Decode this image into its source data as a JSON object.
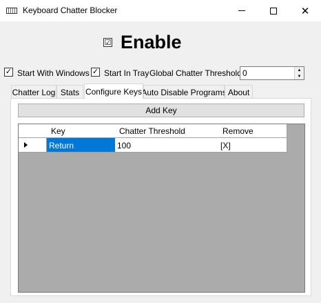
{
  "window": {
    "title": "Keyboard Chatter Blocker"
  },
  "enable": {
    "checked": "☑",
    "label": "Enable"
  },
  "options": {
    "start_with_windows": {
      "checked": "✓",
      "label": "Start With Windows"
    },
    "start_in_tray": {
      "checked": "✓",
      "label": "Start In Tray"
    },
    "threshold_label": "Global Chatter Threshold:",
    "threshold_value": "0"
  },
  "tabs": [
    {
      "label": "Chatter Log",
      "active": false
    },
    {
      "label": "Stats",
      "active": false
    },
    {
      "label": "Configure Keys",
      "active": true
    },
    {
      "label": "Auto Disable Programs",
      "active": false
    },
    {
      "label": "About",
      "active": false
    }
  ],
  "configure_keys": {
    "add_key_label": "Add Key",
    "columns": [
      "Key",
      "Chatter Threshold",
      "Remove"
    ],
    "rows": [
      {
        "key": "Return",
        "threshold": "100",
        "remove": "[X]"
      }
    ]
  },
  "icons": {
    "app": "keyboard-icon",
    "spin_up": "▲",
    "spin_down": "▼"
  },
  "colors": {
    "selection": "#0078d7",
    "grid_background": "#ababab"
  }
}
